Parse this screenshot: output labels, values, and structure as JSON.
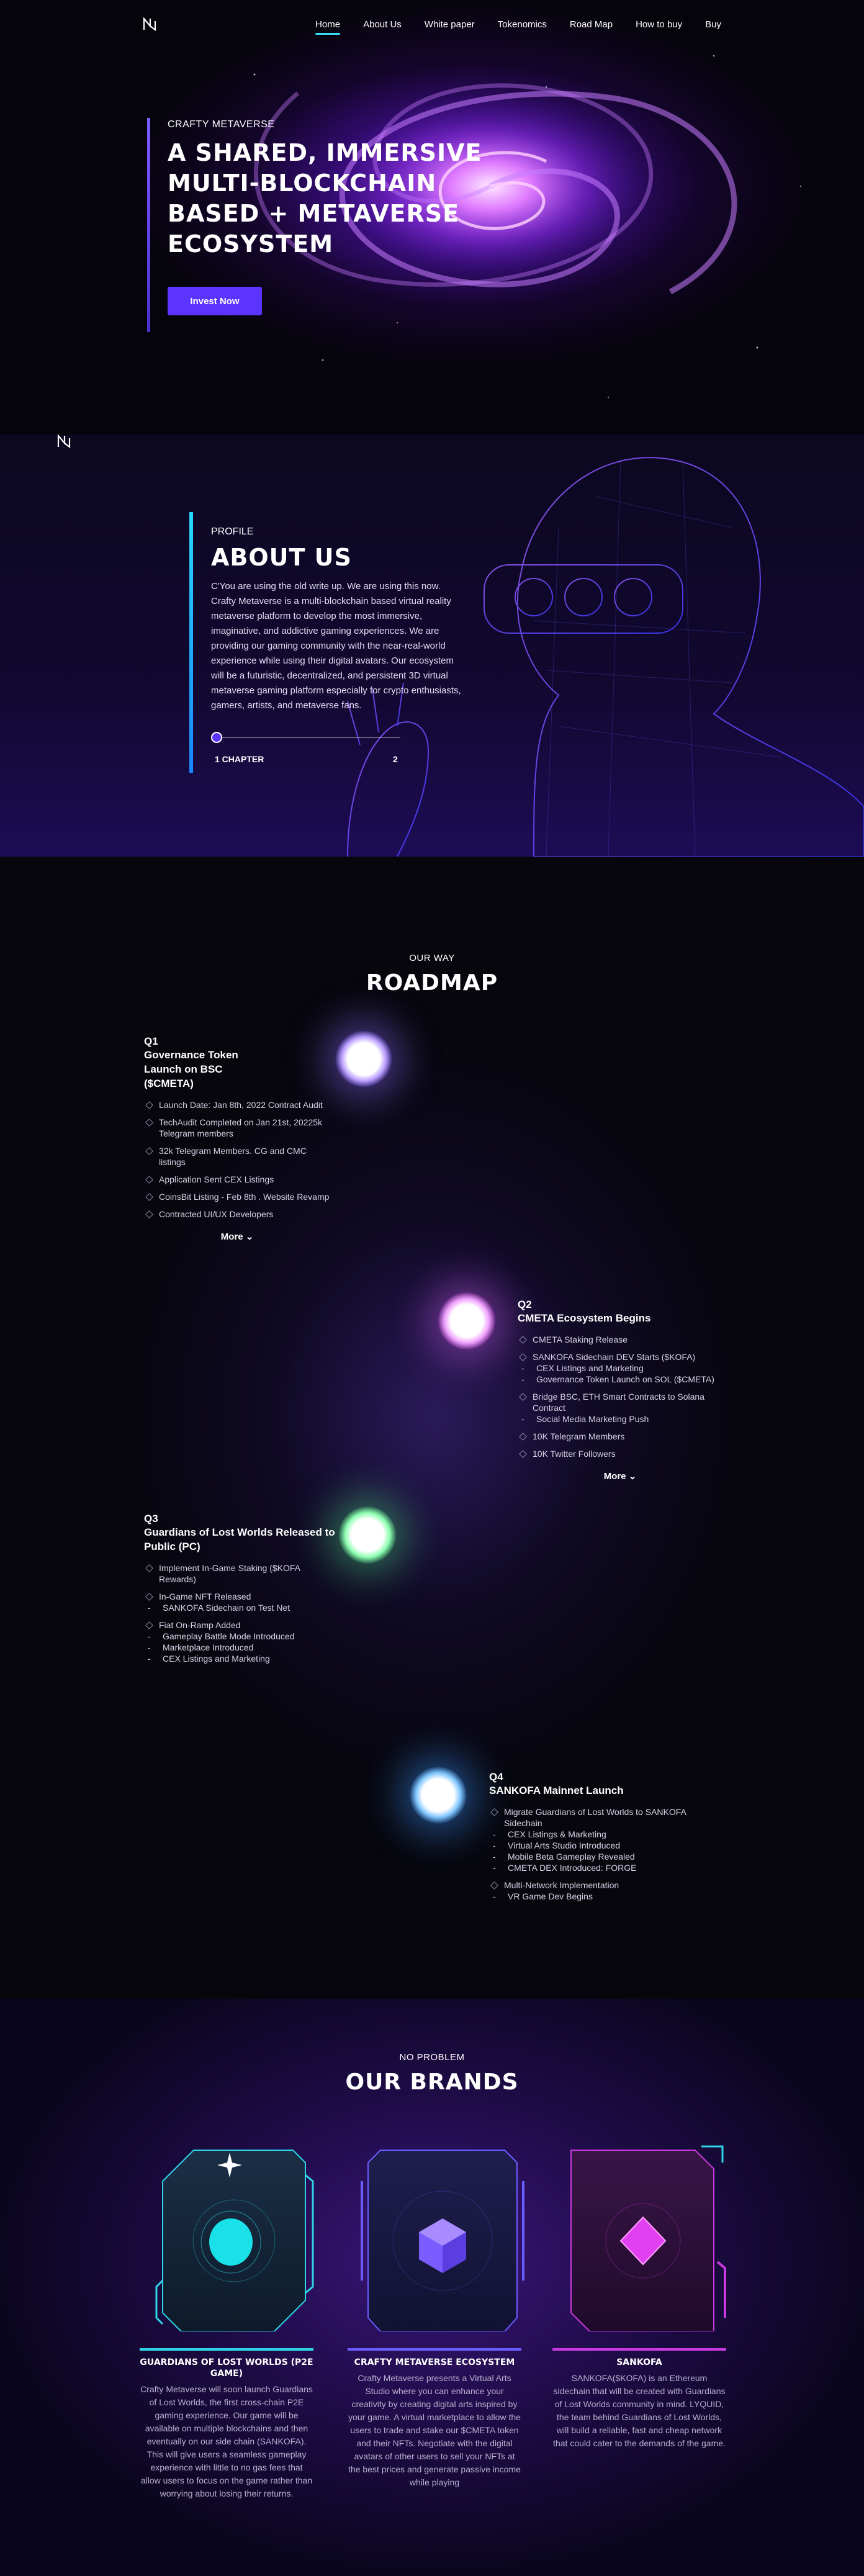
{
  "nav": {
    "items": [
      "Home",
      "About Us",
      "White paper",
      "Tokenomics",
      "Road Map",
      "How to buy",
      "Buy"
    ]
  },
  "hero": {
    "kicker": "CRAFTY METAVERSE",
    "title": "A SHARED, IMMERSIVE MULTI-BLOCKCHAIN BASED + METAVERSE ECOSYSTEM",
    "cta": "Invest Now"
  },
  "about": {
    "kicker": "PROFILE",
    "title": "ABOUT US",
    "text": "C'You are using the old write up. We are using this now. Crafty Metaverse is a multi-blockchain based virtual reality metaverse platform to develop the most immersive, imaginative, and addictive gaming experiences. We are providing our gaming community with the near-real-world experience while using their digital avatars. Our ecosystem will be a futuristic, decentralized, and persistent 3D virtual metaverse gaming platform especially for crypto enthusiasts, gamers, artists, and metaverse fans.",
    "chapter_1": "1 CHAPTER",
    "chapter_2": "2"
  },
  "roadmap": {
    "kicker": "OUR WAY",
    "title": "ROADMAP",
    "more": "More",
    "quarters": [
      {
        "name": "Q1",
        "subtitle": "Governance Token Launch on BSC ($CMETA)",
        "items": [
          {
            "text": "Launch Date: Jan 8th, 2022 Contract Audit",
            "subs": []
          },
          {
            "text": "TechAudit Completed on Jan 21st, 20225k Telegram members",
            "subs": []
          },
          {
            "text": "32k Telegram Members. CG and CMC listings",
            "subs": []
          },
          {
            "text": "Application Sent CEX Listings",
            "subs": []
          },
          {
            "text": "CoinsBit Listing - Feb 8th . Website Revamp",
            "subs": []
          },
          {
            "text": "Contracted UI/UX Developers",
            "subs": []
          }
        ]
      },
      {
        "name": "Q2",
        "subtitle": "CMETA Ecosystem Begins",
        "items": [
          {
            "text": "CMETA Staking Release",
            "subs": []
          },
          {
            "text": "SANKOFA Sidechain DEV Starts ($KOFA)",
            "subs": [
              "CEX Listings and Marketing",
              "Governance Token Launch on SOL ($CMETA)"
            ]
          },
          {
            "text": "Bridge BSC, ETH Smart Contracts to Solana Contract",
            "subs": [
              "Social Media Marketing Push"
            ]
          },
          {
            "text": "10K Telegram Members",
            "subs": []
          },
          {
            "text": "10K Twitter Followers",
            "subs": []
          }
        ]
      },
      {
        "name": "Q3",
        "subtitle": "Guardians of Lost Worlds Released to Public (PC)",
        "items": [
          {
            "text": "Implement In-Game Staking ($KOFA Rewards)",
            "subs": []
          },
          {
            "text": "In-Game NFT Released",
            "subs": [
              "SANKOFA Sidechain on Test Net"
            ]
          },
          {
            "text": "Fiat On-Ramp Added",
            "subs": [
              "Gameplay Battle Mode Introduced",
              "Marketplace Introduced",
              "CEX Listings and Marketing"
            ]
          }
        ]
      },
      {
        "name": "Q4",
        "subtitle": "SANKOFA Mainnet Launch",
        "items": [
          {
            "text": "Migrate Guardians of Lost Worlds to SANKOFA Sidechain",
            "subs": [
              "CEX Listings & Marketing",
              "Virtual Arts Studio Introduced",
              "Mobile Beta Gameplay Revealed",
              "CMETA DEX Introduced: FORGE"
            ]
          },
          {
            "text": "Multi-Network Implementation",
            "subs": [
              "VR Game Dev Begins"
            ]
          }
        ]
      }
    ]
  },
  "brands": {
    "kicker": "NO PROBLEM",
    "title": "OUR BRANDS",
    "items": [
      {
        "name": "GUARDIANS OF LOST WORLDS (P2E GAME)",
        "text": "Crafty Metaverse will soon launch Guardians of Lost Worlds, the first cross-chain P2E gaming experience. Our game will be available on multiple blockchains and then eventually on our side chain (SANKOFA). This will give users a seamless gameplay experience with little to no gas fees that allow users to focus on the game rather than worrying about losing their returns.",
        "color": "#2fd4e6",
        "icon": "circle-gem-icon"
      },
      {
        "name": "CRAFTY METAVERSE ECOSYSTEM",
        "text": "Crafty Metaverse presents a Virtual Arts Studio where you can enhance your creativity by creating digital arts inspired by your game. A virtual marketplace to allow the users to trade and stake our $CMETA token and their NFTs. Negotiate with the digital avatars of other users to sell your NFTs at the best prices and generate passive income while playing",
        "color": "#6a5cff",
        "icon": "cube-icon"
      },
      {
        "name": "SANKOFA",
        "text": "SANKOFA($KOFA) is an Ethereum sidechain that will be created with Guardians of Lost Worlds community in mind. LYQUID, the team behind Guardians of Lost Worlds, will build a reliable, fast and cheap network that could cater to the demands of the game.",
        "color": "#c83ae0",
        "icon": "diamond-icon"
      }
    ]
  },
  "colors": {
    "accent": "#5b34ff",
    "cyan": "#39e0ff"
  }
}
